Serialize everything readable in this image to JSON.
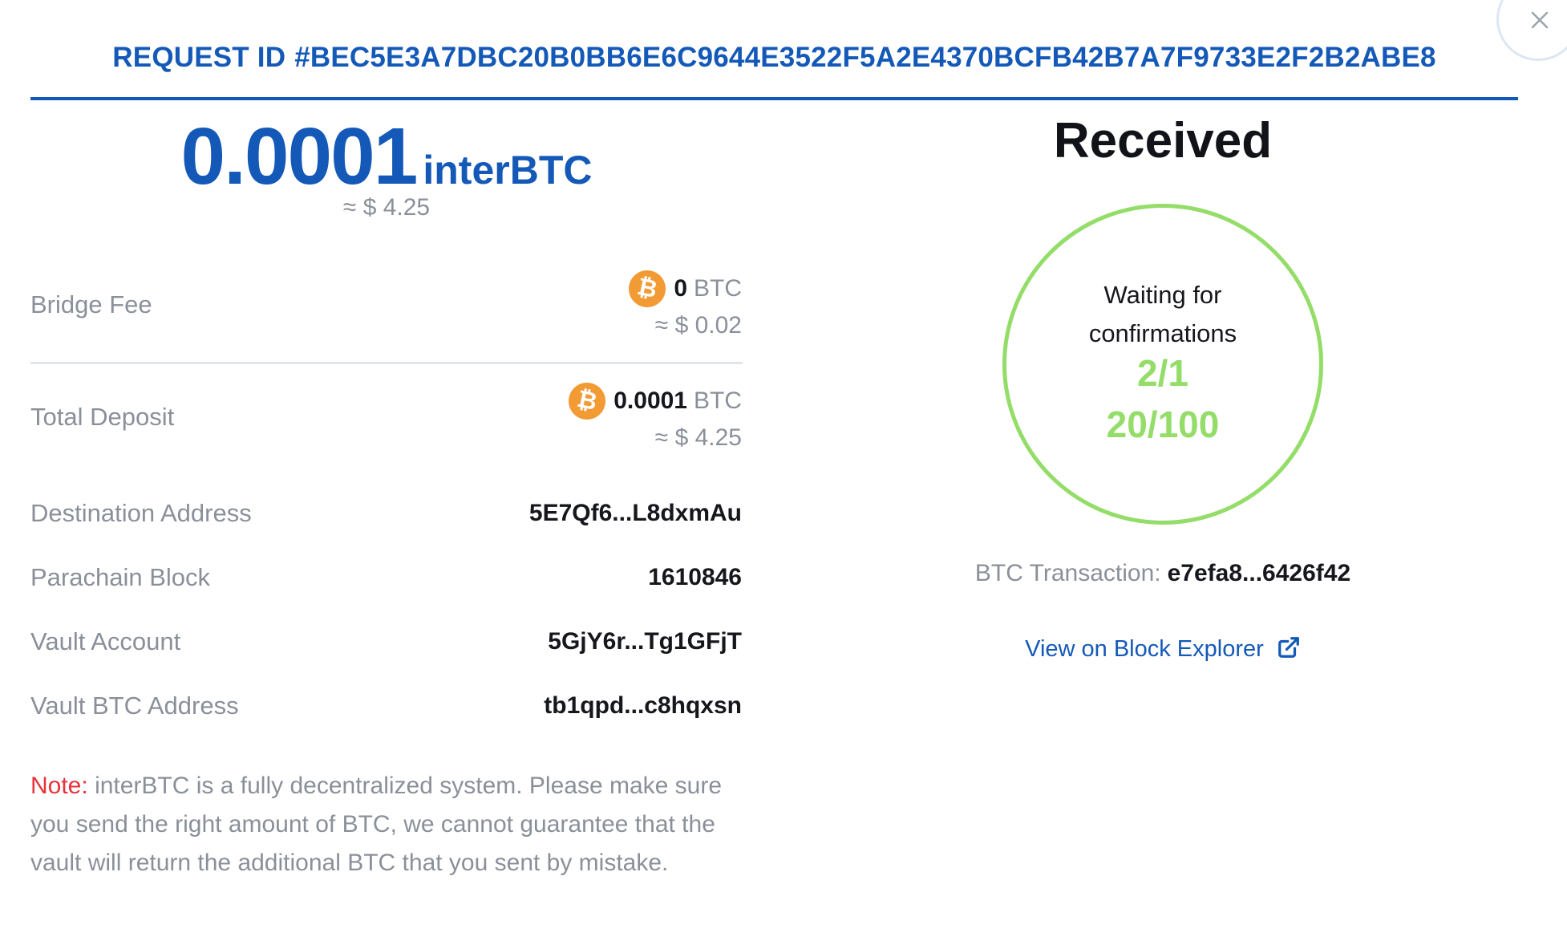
{
  "modal": {
    "request_id_label": "REQUEST ID",
    "request_id": "#BEC5E3A7DBC20B0BB6E6C9644E3522F5A2E4370BCFB42B7A7F9733E2F2B2ABE8",
    "close_icon": "close-icon"
  },
  "amount": {
    "value": "0.0001",
    "unit": "interBTC",
    "usd": "≈ $ 4.25"
  },
  "details": {
    "bridge_fee": {
      "label": "Bridge Fee",
      "amount": "0",
      "unit": "BTC",
      "usd": "≈ $ 0.02",
      "icon": "bitcoin-icon"
    },
    "total_deposit": {
      "label": "Total Deposit",
      "amount": "0.0001",
      "unit": "BTC",
      "usd": "≈ $ 4.25",
      "icon": "bitcoin-icon"
    },
    "destination_address": {
      "label": "Destination Address",
      "value": "5E7Qf6...L8dxmAu"
    },
    "parachain_block": {
      "label": "Parachain Block",
      "value": "1610846"
    },
    "vault_account": {
      "label": "Vault Account",
      "value": "5GjY6r...Tg1GFjT"
    },
    "vault_btc_address": {
      "label": "Vault BTC Address",
      "value": "tb1qpd...c8hqxsn"
    }
  },
  "note": {
    "label": "Note:",
    "text": "interBTC is a fully decentralized system. Please make sure you send the right amount of BTC, we cannot guarantee that the vault will return the additional BTC that you sent by mistake."
  },
  "status": {
    "title": "Received",
    "waiting_line1": "Waiting for",
    "waiting_line2": "confirmations",
    "btc_confirmations": "2/1",
    "parachain_confirmations": "20/100",
    "ring_color": "#93dd68"
  },
  "transaction": {
    "label": "BTC Transaction:",
    "value": "e7efa8...6426f42",
    "explorer_link": "View on Block Explorer",
    "link_icon": "external-link-icon"
  },
  "colors": {
    "accent": "#1459b8",
    "bitcoin": "#f29a33",
    "success": "#93dd68",
    "note": "#e8323a"
  }
}
